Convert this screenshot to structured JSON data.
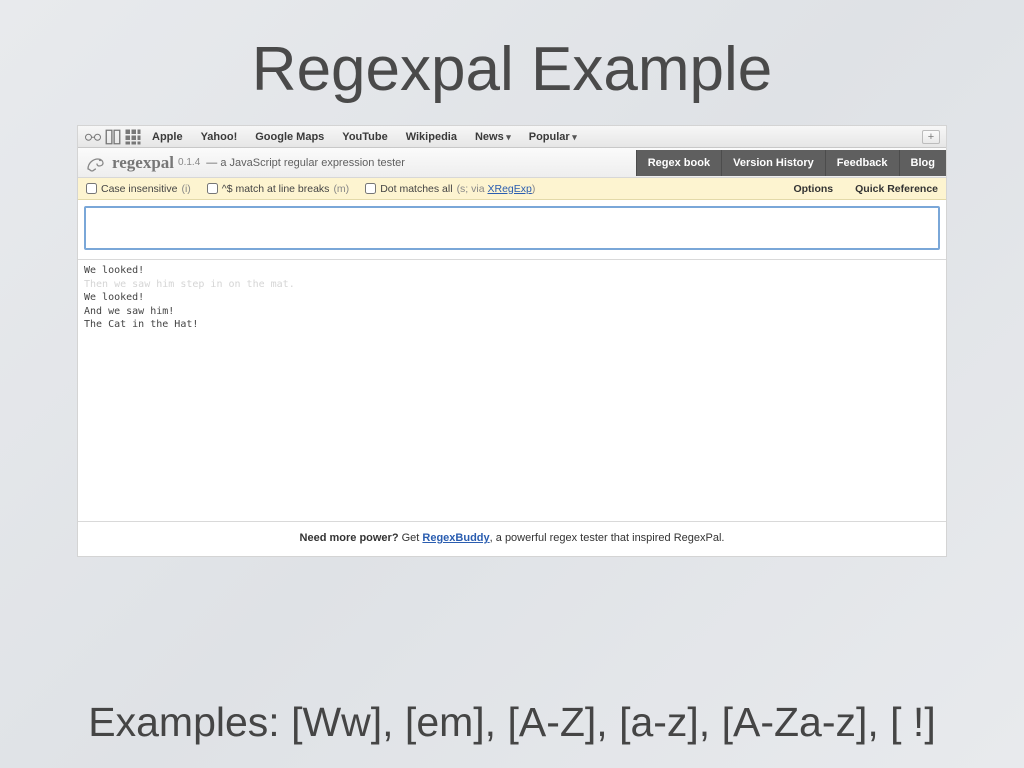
{
  "slide": {
    "title": "Regexpal Example",
    "examples_text": "Examples: [Ww], [em], [A-Z], [a-z], [A-Za-z], [ !]"
  },
  "bookmarks": {
    "items": [
      "Apple",
      "Yahoo!",
      "Google Maps",
      "YouTube",
      "Wikipedia",
      "News",
      "Popular"
    ]
  },
  "header": {
    "brand": "regexpal",
    "version": "0.1.4",
    "tagline": "— a JavaScript regular expression tester",
    "tabs": [
      "Regex book",
      "Version History",
      "Feedback",
      "Blog"
    ]
  },
  "options": {
    "case_insensitive": {
      "label": "Case insensitive",
      "flag": "(i)"
    },
    "multiline": {
      "label": "^$ match at line breaks",
      "flag": "(m)"
    },
    "dotall": {
      "label": "Dot matches all",
      "flag": "(s; via ",
      "link": "XRegExp",
      "suffix": ")"
    },
    "right": [
      "Options",
      "Quick Reference"
    ]
  },
  "regex_input": {
    "value": ""
  },
  "test_text": {
    "lines": [
      {
        "text": "We looked!",
        "faded": false
      },
      {
        "text": "Then we saw him step in on the mat.",
        "faded": true
      },
      {
        "text": "We looked!",
        "faded": false
      },
      {
        "text": "And we saw him!",
        "faded": false
      },
      {
        "text": "The Cat in the Hat!",
        "faded": false
      }
    ]
  },
  "footer": {
    "lead": "Need more power?",
    "mid": " Get ",
    "link": "RegexBuddy",
    "tail": ", a powerful regex tester that inspired RegexPal."
  }
}
